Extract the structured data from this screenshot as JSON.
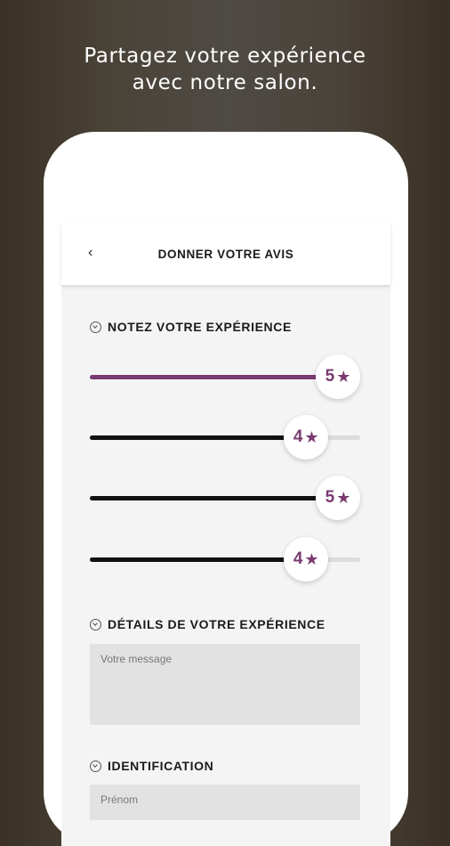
{
  "headline": {
    "line1": "Partagez votre expérience",
    "line2": "avec notre salon."
  },
  "topbar": {
    "back_icon": "chevron-left-icon",
    "back_glyph": "‹",
    "title": "DONNER VOTRE AVIS"
  },
  "sections": {
    "rating": "NOTEZ VOTRE EXPÉRIENCE",
    "details": "DÉTAILS DE VOTRE EXPÉRIENCE",
    "identification": "IDENTIFICATION"
  },
  "ratings": [
    {
      "value": "5",
      "max": 5,
      "fill_color": "#7a3b70"
    },
    {
      "value": "4",
      "max": 5,
      "fill_color": "#111111"
    },
    {
      "value": "5",
      "max": 5,
      "fill_color": "#111111"
    },
    {
      "value": "4",
      "max": 5,
      "fill_color": "#111111"
    }
  ],
  "star_glyph": "★",
  "fields": {
    "message_placeholder": "Votre message",
    "firstname_placeholder": "Prénom"
  },
  "colors": {
    "accent": "#7a3b70"
  }
}
